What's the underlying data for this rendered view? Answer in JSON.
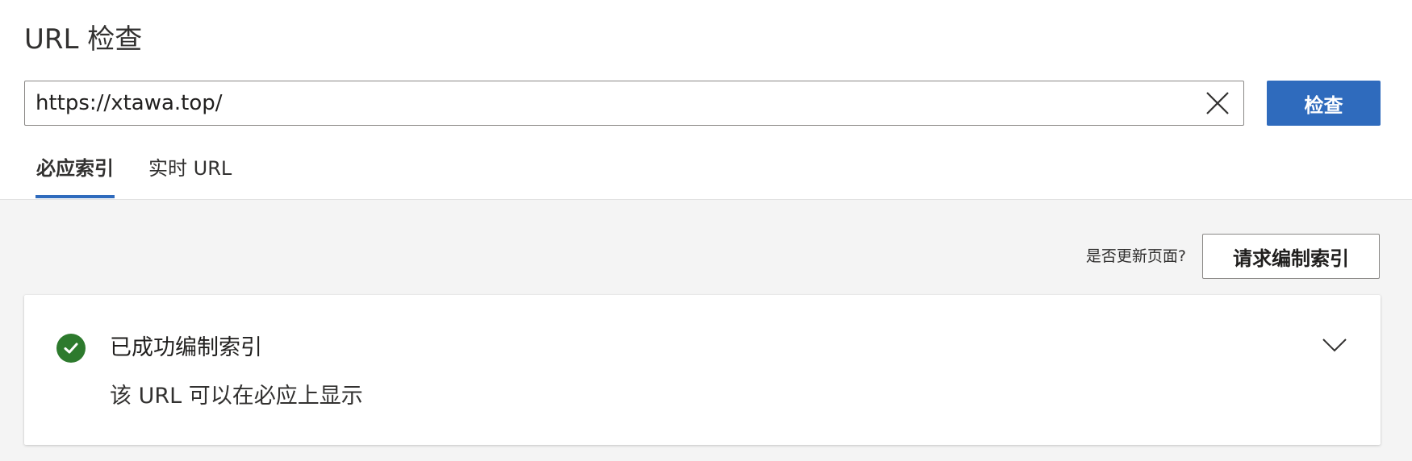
{
  "page": {
    "title": "URL 检查"
  },
  "search": {
    "value": "https://xtawa.top/",
    "clear_icon": "close-icon",
    "button_label": "检查"
  },
  "tabs": [
    {
      "label": "必应索引",
      "active": true
    },
    {
      "label": "实时 URL",
      "active": false
    }
  ],
  "actions": {
    "update_question": "是否更新页面?",
    "request_label": "请求编制索引"
  },
  "status": {
    "icon": "check-circle-icon",
    "title": "已成功编制索引",
    "description": "该 URL 可以在必应上显示",
    "expand_icon": "chevron-down-icon"
  },
  "colors": {
    "accent": "#2f6bbd",
    "success": "#2d7a2d",
    "panel_bg": "#f4f4f4"
  }
}
